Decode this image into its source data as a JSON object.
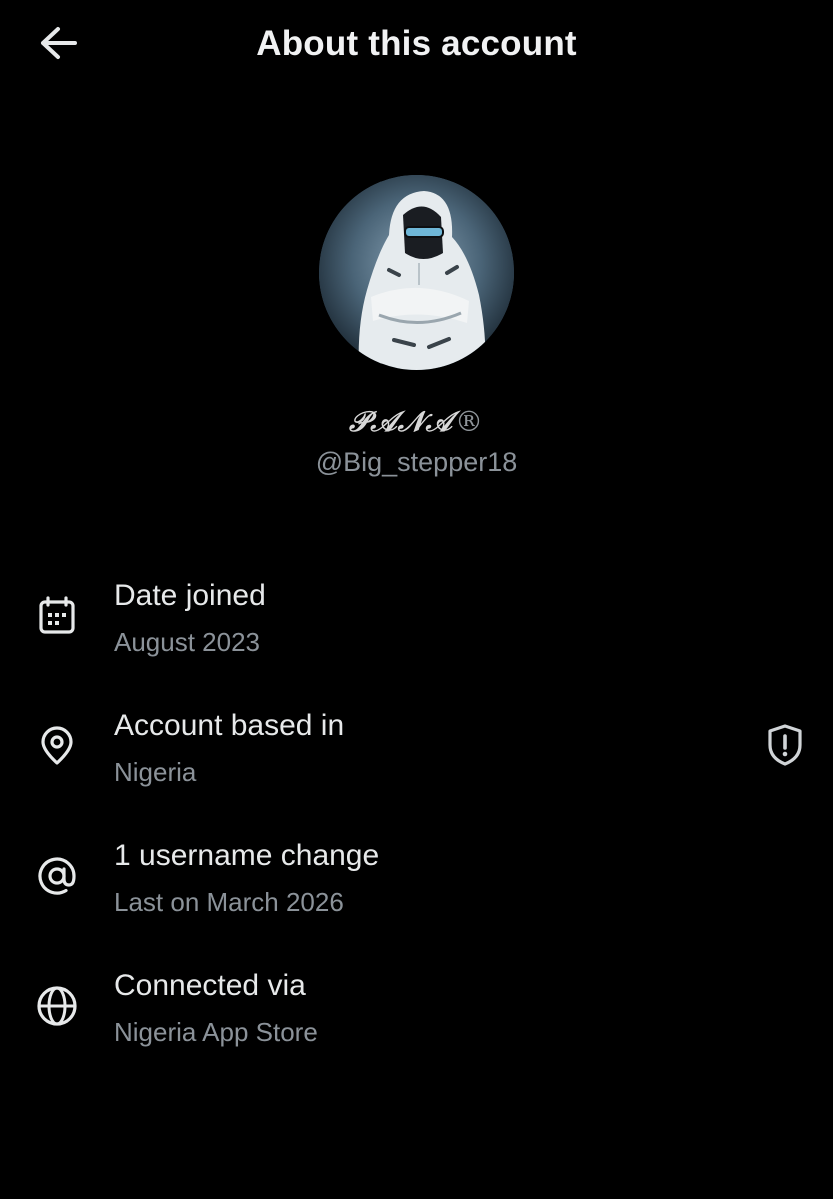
{
  "header": {
    "title": "About this account",
    "back_icon": "arrow-left-icon"
  },
  "profile": {
    "display_name": "𝒫𝒜𝒩𝒜",
    "registered_mark": "®",
    "handle": "@Big_stepper18",
    "avatar": "avatar-photo"
  },
  "info": {
    "date_joined": {
      "title": "Date joined",
      "value": "August 2023",
      "icon": "calendar-icon"
    },
    "based_in": {
      "title": "Account based in",
      "value": "Nigeria",
      "icon": "location-pin-icon",
      "action_icon": "shield-alert-icon"
    },
    "username_change": {
      "title": "1 username change",
      "value": "Last on March 2026",
      "icon": "at-sign-icon"
    },
    "connected_via": {
      "title": "Connected via",
      "value": "Nigeria App Store",
      "icon": "globe-icon"
    }
  },
  "colors": {
    "background": "#000000",
    "primary_text": "#e7e9ea",
    "secondary_text": "#8b9299"
  }
}
